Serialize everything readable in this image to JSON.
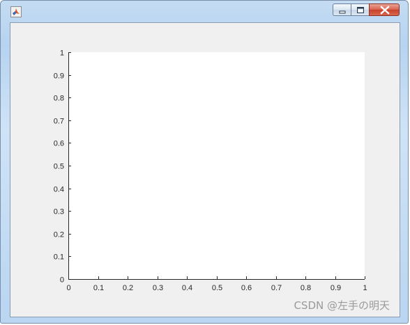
{
  "window": {
    "icon": "matlab-icon",
    "controls": [
      "minimize-icon",
      "maximize-icon",
      "close-icon"
    ]
  },
  "chart_data": {
    "type": "line",
    "title": "",
    "xlabel": "",
    "ylabel": "",
    "xlim": [
      0,
      1
    ],
    "ylim": [
      0,
      1
    ],
    "x_ticks": [
      "0",
      "0.1",
      "0.2",
      "0.3",
      "0.4",
      "0.5",
      "0.6",
      "0.7",
      "0.8",
      "0.9",
      "1"
    ],
    "y_ticks": [
      "0",
      "0.1",
      "0.2",
      "0.3",
      "0.4",
      "0.5",
      "0.6",
      "0.7",
      "0.8",
      "0.9",
      "1"
    ],
    "grid": false,
    "series": []
  },
  "watermark": "CSDN @左手の明天"
}
